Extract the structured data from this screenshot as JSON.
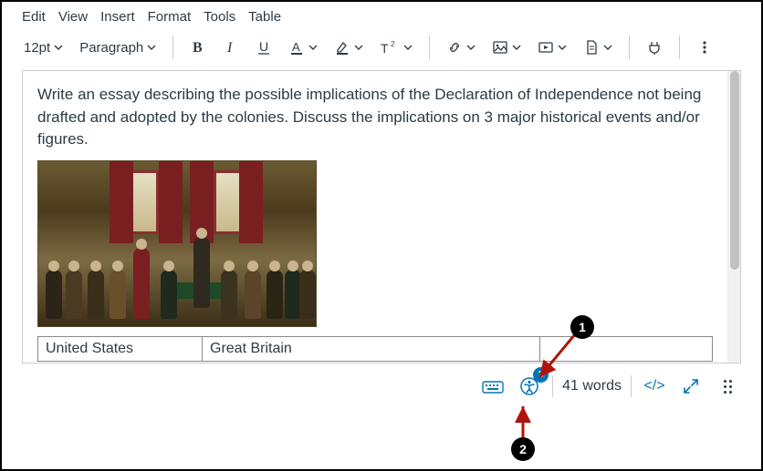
{
  "menubar": {
    "edit": "Edit",
    "view": "View",
    "insert": "Insert",
    "format": "Format",
    "tools": "Tools",
    "table": "Table"
  },
  "toolbar": {
    "font_size": "12pt",
    "block_format": "Paragraph"
  },
  "content": {
    "essay_prompt": "Write an essay describing the possible implications of the Declaration of Independence not being drafted and adopted by the colonies. Discuss the implications on 3 major historical events and/or figures.",
    "table": {
      "cells": {
        "c0": "United States",
        "c1": "Great Britain",
        "c2": ""
      }
    }
  },
  "statusbar": {
    "word_count": "41 words",
    "html_view": "</>",
    "a11y_badge": "3"
  },
  "annotations": {
    "callout1": "1",
    "callout2": "2"
  }
}
